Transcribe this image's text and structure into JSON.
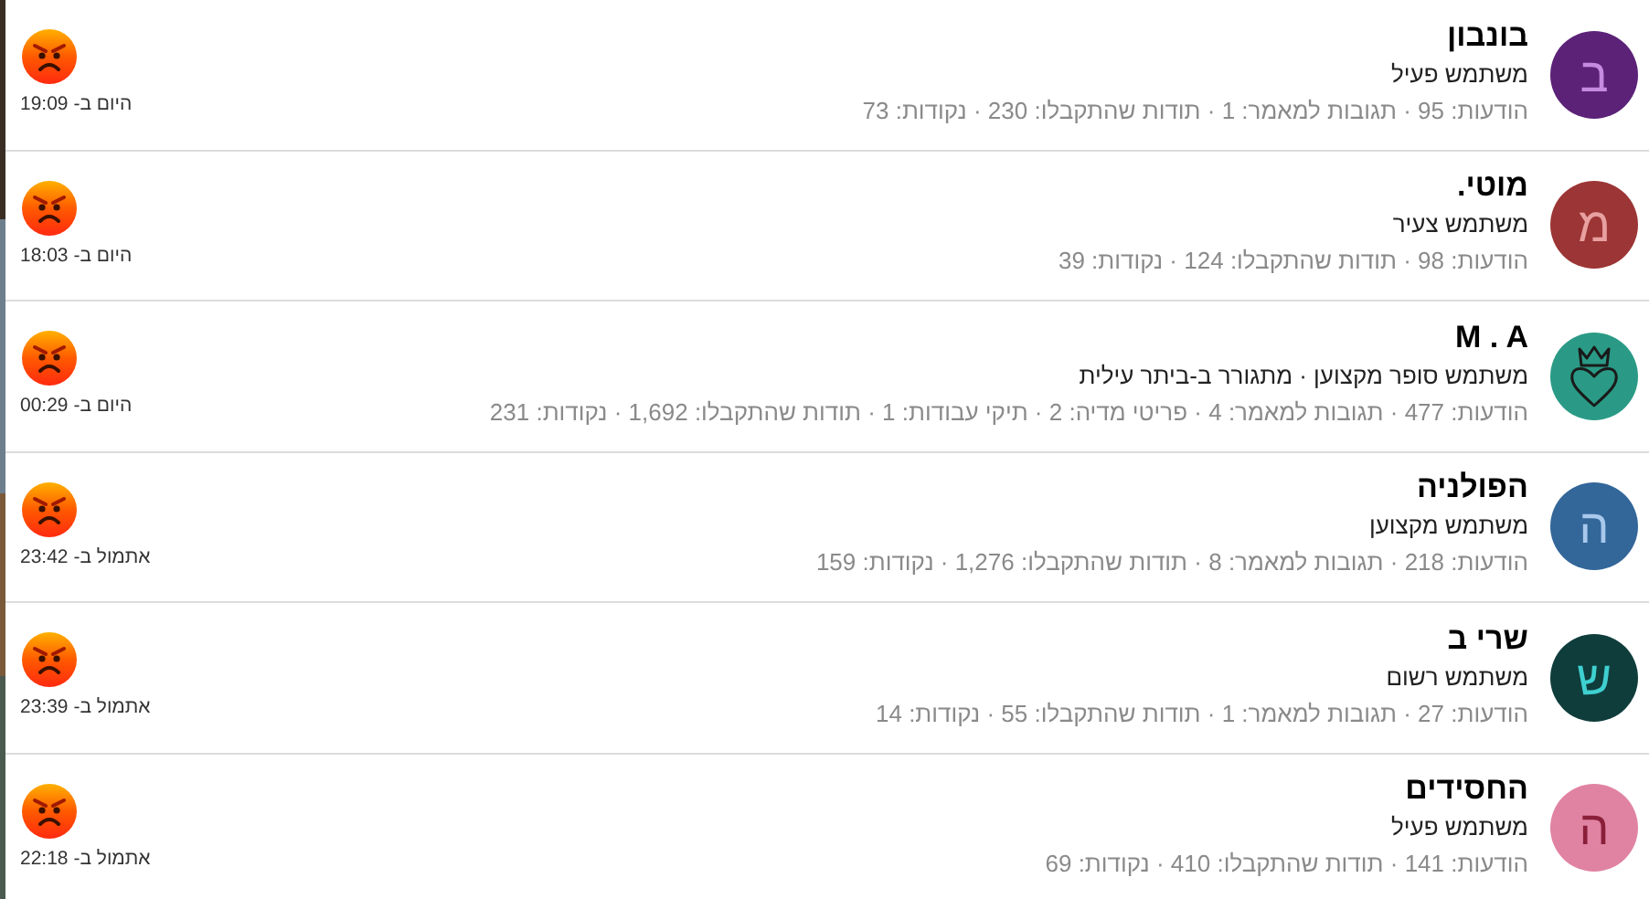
{
  "members": [
    {
      "name": "בונבון",
      "avatar": {
        "kind": "letter",
        "color": "#5b2278",
        "letter": {
          "text": "ב",
          "color": "#c48be0"
        }
      },
      "title": "משתמש פעיל",
      "stats": "הודעות: 95 · תגובות למאמר: 1 · תודות שהתקבלו: 230 · נקודות: 73",
      "time": "היום ב- 19:09"
    },
    {
      "name": "מוטי.",
      "avatar": {
        "kind": "letter",
        "color": "#9c3535",
        "letter": {
          "text": "מ",
          "color": "#e8a0a0"
        }
      },
      "title": "משתמש צעיר",
      "stats": "הודעות: 98 · תודות שהתקבלו: 124 · נקודות: 39",
      "time": "היום ב- 18:03"
    },
    {
      "name": "M . A",
      "avatar": {
        "kind": "drawing",
        "color": "#2a9a86"
      },
      "title": "משתמש סופר מקצוען · מתגורר ב-ביתר עילית",
      "stats": "הודעות: 477 · תגובות למאמר: 4 · פריטי מדיה: 2 · תיקי עבודות: 1 · תודות שהתקבלו: 1,692 · נקודות: 231",
      "time": "היום ב- 00:29"
    },
    {
      "name": "הפולניה",
      "avatar": {
        "kind": "letter",
        "color": "#336699",
        "letter": {
          "text": "ה",
          "color": "#a8c8ec"
        }
      },
      "title": "משתמש מקצוען",
      "stats": "הודעות: 218 · תגובות למאמר: 8 · תודות שהתקבלו: 1,276 · נקודות: 159",
      "time": "אתמול ב- 23:42"
    },
    {
      "name": "שרי ב",
      "avatar": {
        "kind": "letter",
        "color": "#0f3d3c",
        "letter": {
          "text": "ש",
          "color": "#3fd0d0"
        }
      },
      "title": "משתמש רשום",
      "stats": "הודעות: 27 · תגובות למאמר: 1 · תודות שהתקבלו: 55 · נקודות: 14",
      "time": "אתמול ב- 23:39"
    },
    {
      "name": "החסידים",
      "avatar": {
        "kind": "letter",
        "color": "#e083a3",
        "letter": {
          "text": "ה",
          "color": "#8a1f3a"
        }
      },
      "title": "משתמש פעיל",
      "stats": "הודעות: 141 · תודות שהתקבלו: 410 · נקודות: 69",
      "time": "אתמול ב- 22:18"
    }
  ]
}
